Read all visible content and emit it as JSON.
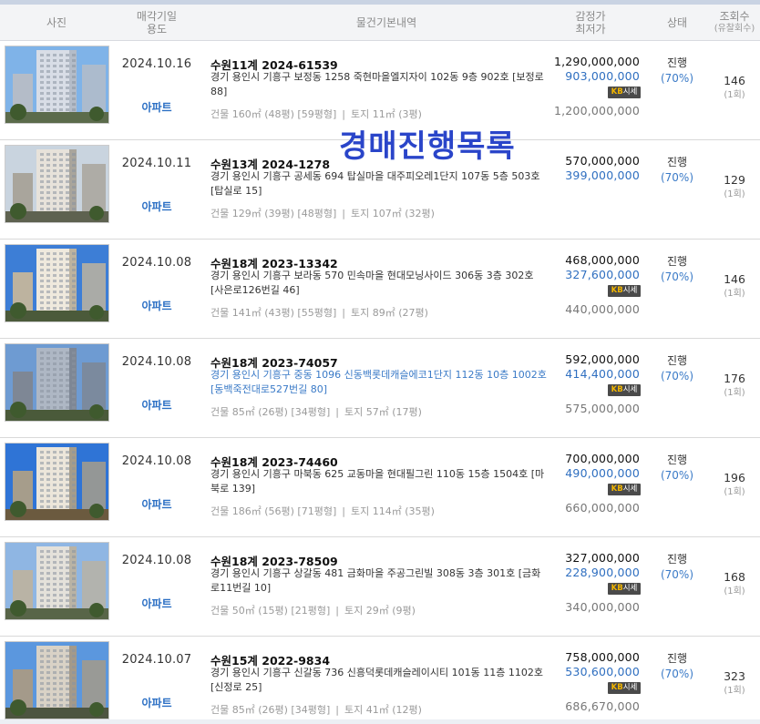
{
  "header": {
    "photo": "사진",
    "date_line1": "매각기일",
    "date_line2": "용도",
    "basic": "물건기본내역",
    "price_line1": "감정가",
    "price_line2": "최저가",
    "status": "상태",
    "views_line1": "조회수",
    "views_line2": "(유찰회수)"
  },
  "watermark": "경매진행목록",
  "rows": [
    {
      "date": "2024.10.16",
      "type": "아파트",
      "case": "수원11계 2024-61539",
      "address": "경기 용인시 기흥구 보정동 1258 죽현마을엘지자이 102동 9층 902호 [보정로 88]",
      "area_building": "건물 160㎡ (48평) [59평형]",
      "area_land": "토지 11㎡ (3평)",
      "appraised": "1,290,000,000",
      "minimum": "903,000,000",
      "kb_label": "시세",
      "market": "1,200,000,000",
      "status": "진행",
      "percent": "(70%)",
      "views": "146",
      "bids": "(1회)"
    },
    {
      "date": "2024.10.11",
      "type": "아파트",
      "case": "수원13계 2024-1278",
      "address": "경기 용인시 기흥구 공세동 694 탑실마을 대주피오레1단지 107동 5층 503호 [탑실로 15]",
      "area_building": "건물 129㎡ (39평) [48평형]",
      "area_land": "토지 107㎡ (32평)",
      "appraised": "570,000,000",
      "minimum": "399,000,000",
      "kb_label": "",
      "market": "",
      "status": "진행",
      "percent": "(70%)",
      "views": "129",
      "bids": "(1회)"
    },
    {
      "date": "2024.10.08",
      "type": "아파트",
      "case": "수원18계 2023-13342",
      "address": "경기 용인시 기흥구 보라동 570 민속마을 현대모닝사이드 306동 3층 302호 [사은로126번길 46]",
      "area_building": "건물 141㎡ (43평) [55평형]",
      "area_land": "토지 89㎡ (27평)",
      "appraised": "468,000,000",
      "minimum": "327,600,000",
      "kb_label": "시세",
      "market": "440,000,000",
      "status": "진행",
      "percent": "(70%)",
      "views": "146",
      "bids": "(1회)"
    },
    {
      "date": "2024.10.08",
      "type": "아파트",
      "case": "수원18계 2023-74057",
      "address": "경기 용인시 기흥구 중동 1096 신동백롯데캐슬에코1단지 112동 10층 1002호 [동백죽전대로527번길 80]",
      "area_building": "건물 85㎡ (26평) [34평형]",
      "area_land": "토지 57㎡ (17평)",
      "appraised": "592,000,000",
      "minimum": "414,400,000",
      "kb_label": "시세",
      "market": "575,000,000",
      "status": "진행",
      "percent": "(70%)",
      "views": "176",
      "bids": "(1회)"
    },
    {
      "date": "2024.10.08",
      "type": "아파트",
      "case": "수원18계 2023-74460",
      "address": "경기 용인시 기흥구 마북동 625 교동마을 현대필그린 110동 15층 1504호 [마북로 139]",
      "area_building": "건물 186㎡ (56평) [71평형]",
      "area_land": "토지 114㎡ (35평)",
      "appraised": "700,000,000",
      "minimum": "490,000,000",
      "kb_label": "시세",
      "market": "660,000,000",
      "status": "진행",
      "percent": "(70%)",
      "views": "196",
      "bids": "(1회)"
    },
    {
      "date": "2024.10.08",
      "type": "아파트",
      "case": "수원18계 2023-78509",
      "address": "경기 용인시 기흥구 상갈동 481 금화마을 주공그린빌 308동 3층 301호 [금화로11번길 10]",
      "area_building": "건물 50㎡ (15평) [21평형]",
      "area_land": "토지 29㎡ (9평)",
      "appraised": "327,000,000",
      "minimum": "228,900,000",
      "kb_label": "시세",
      "market": "340,000,000",
      "status": "진행",
      "percent": "(70%)",
      "views": "168",
      "bids": "(1회)"
    },
    {
      "date": "2024.10.07",
      "type": "아파트",
      "case": "수원15계 2022-9834",
      "address": "경기 용인시 기흥구 신갈동 736 신흥덕롯데캐슬레이시티 101동 11층 1102호 [신정로 25]",
      "area_building": "건물 85㎡ (26평) [34평형]",
      "area_land": "토지 41㎡ (12평)",
      "appraised": "758,000,000",
      "minimum": "530,600,000",
      "kb_label": "시세",
      "market": "686,670,000",
      "status": "진행",
      "percent": "(70%)",
      "views": "323",
      "bids": "(1회)"
    }
  ],
  "kb_brand": "KB",
  "area_separator": "|"
}
